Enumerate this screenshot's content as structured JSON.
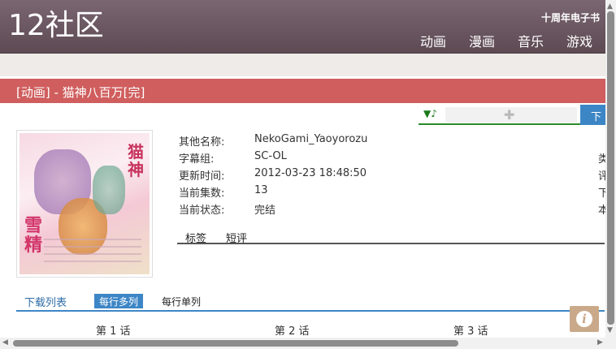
{
  "site": {
    "logo": "12社区",
    "anniversary_link": "十周年电子书",
    "nav": [
      "动画",
      "漫画",
      "音乐",
      "游戏"
    ]
  },
  "page": {
    "title": "[动画] - 猫神八百万[完]"
  },
  "music_player": {
    "icon": "▼♪"
  },
  "download_button": {
    "label": "下"
  },
  "cover": {
    "title_vertical": "猫神",
    "subtitle_vertical": "雪精"
  },
  "info": {
    "rows": [
      {
        "label": "其他名称:",
        "value": "NekoGami_Yaoyorozu"
      },
      {
        "label": "字幕组:",
        "value": "SC-OL"
      },
      {
        "label": "更新时间:",
        "value": "2012-03-23 18:48:50"
      },
      {
        "label": "当前集数:",
        "value": "13"
      },
      {
        "label": "当前状态:",
        "value": "完结"
      }
    ],
    "right_column": [
      "类",
      "评",
      "下",
      "本"
    ]
  },
  "subtabs": [
    "标签",
    "短评"
  ],
  "download_tabs": {
    "list_label": "下载列表",
    "multi_label": "每行多列",
    "single_label": "每行单列"
  },
  "episodes": [
    "第 1 话",
    "第 2 话",
    "第 3 话"
  ],
  "colors": {
    "header": "#6e5a63",
    "title_bar": "#d05e5e",
    "accent_blue": "#3d86c6",
    "music_green": "#2a8a2a",
    "info_button": "#c9a98a"
  }
}
